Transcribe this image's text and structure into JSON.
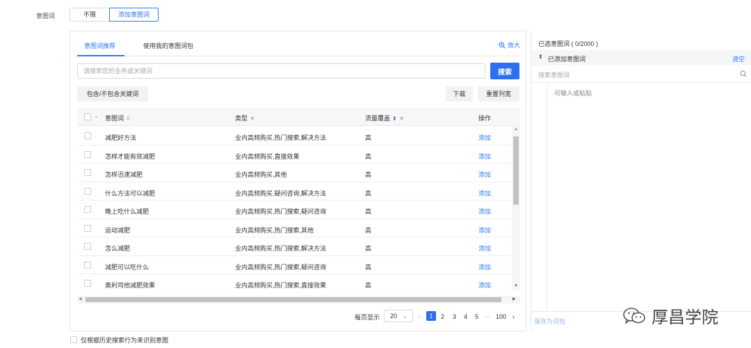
{
  "filter_row": {
    "label": "意图词",
    "options": [
      "不限",
      "添加意图词"
    ],
    "selected": "添加意图词"
  },
  "tabs": [
    {
      "label": "意图词推荐",
      "active": true
    },
    {
      "label": "使用我的意图词包",
      "active": false
    }
  ],
  "zoom_label": "放大",
  "search": {
    "placeholder": "请搜索您的业务或关键词",
    "button": "搜索"
  },
  "toolbar": {
    "include_exclude": "包含/不包含关键词",
    "download": "下载",
    "reset_columns": "重置列宽"
  },
  "table": {
    "columns": {
      "keyword": "意图词",
      "type": "类型",
      "coverage": "流量覆盖",
      "action": "操作"
    },
    "rows": [
      {
        "keyword": "减肥好方法",
        "type": "业内高频购买,热门搜索,解决方法",
        "coverage": "高",
        "action": "添加"
      },
      {
        "keyword": "怎样才能有效减肥",
        "type": "业内高频购买,直接效果",
        "coverage": "高",
        "action": "添加"
      },
      {
        "keyword": "怎样迅速减肥",
        "type": "业内高频购买,其他",
        "coverage": "高",
        "action": "添加"
      },
      {
        "keyword": "什么方法可以减肥",
        "type": "业内高频购买,疑问咨询,解决方法",
        "coverage": "高",
        "action": "添加"
      },
      {
        "keyword": "晚上吃什么减肥",
        "type": "业内高频购买,热门搜索,疑问咨询",
        "coverage": "高",
        "action": "添加"
      },
      {
        "keyword": "运动减肥",
        "type": "业内高频购买,热门搜索,其他",
        "coverage": "高",
        "action": "添加"
      },
      {
        "keyword": "怎么减肥",
        "type": "业内高频购买,热门搜索,解决方法",
        "coverage": "高",
        "action": "添加"
      },
      {
        "keyword": "减肥可以吃什么",
        "type": "业内高频购买,热门搜索,疑问咨询",
        "coverage": "高",
        "action": "添加"
      },
      {
        "keyword": "奥利司他减肥效果",
        "type": "业内高频购买,热门搜索,直接效果",
        "coverage": "高",
        "action": "添加"
      }
    ]
  },
  "pagination": {
    "per_page_label": "每页显示",
    "page_size": "20",
    "pages": [
      "1",
      "2",
      "3",
      "4",
      "5",
      "···",
      "100"
    ],
    "current": "1"
  },
  "selected_panel": {
    "title": "已选意图词 ( 0/2000 )",
    "section_label": "已添加意图词",
    "clear": "清空",
    "search_placeholder": "搜索意图词",
    "input_placeholder": "可输入或粘贴",
    "save_as_pack": "保存为词包"
  },
  "watermark": "厚昌学院",
  "bottom_option": "仅根据历史搜索行为来识别意图",
  "colors": {
    "accent": "#2d78f4",
    "primary_button": "#2d6ff0"
  }
}
